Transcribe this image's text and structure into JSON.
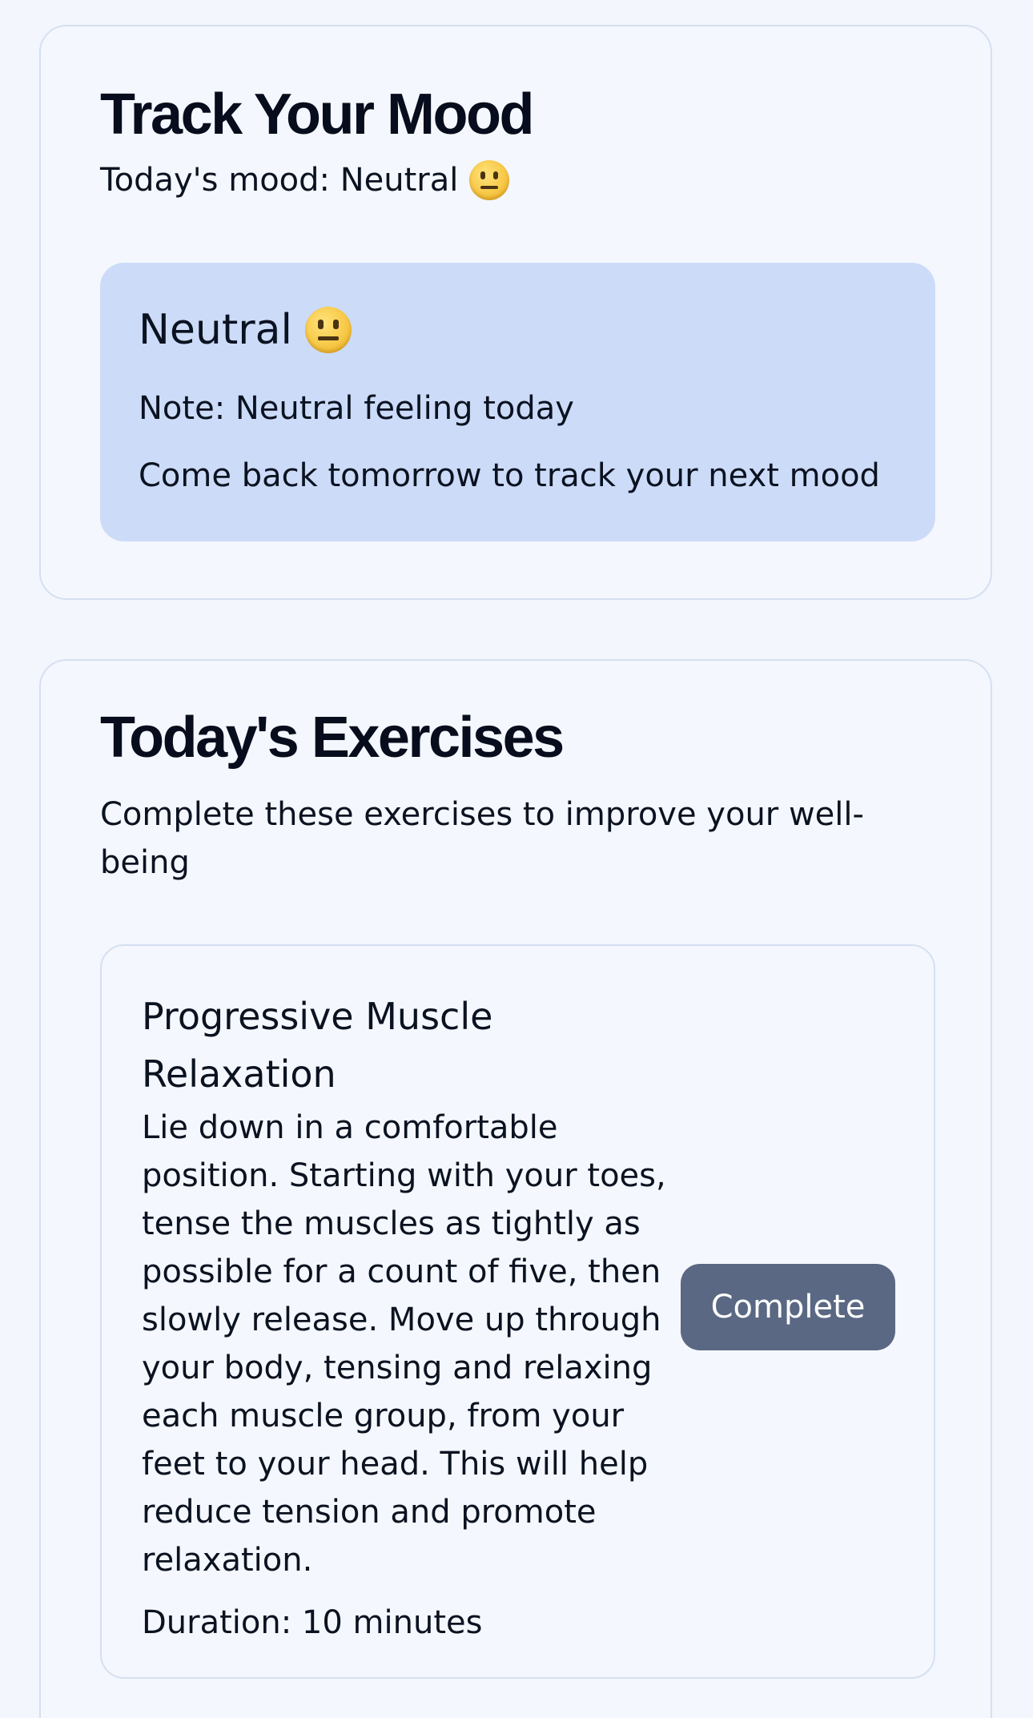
{
  "mood_card": {
    "title": "Track Your Mood",
    "todays_mood_prefix": "Today's mood: ",
    "todays_mood_value": "Neutral",
    "mood_icon": "neutral-face-icon",
    "entry": {
      "mood": "Neutral",
      "note": "Note: Neutral feeling today",
      "hint": "Come back tomorrow to track your next mood"
    }
  },
  "exercises_card": {
    "title": "Today's Exercises",
    "subtitle": "Complete these exercises to improve your well-being",
    "items": [
      {
        "title": "Progressive Muscle Relaxation",
        "description": "Lie down in a comfortable position. Starting with your toes, tense the muscles as tightly as possible for a count of five, then slowly release. Move up through your body, tensing and relaxing each muscle group, from your feet to your head. This will help reduce tension and promote relaxation.",
        "duration": "Duration: 10 minutes",
        "button_label": "Complete"
      }
    ]
  },
  "colors": {
    "background": "#f3f6fc",
    "card_border": "#d5e0f2",
    "mood_entry_bg": "#ccdbf8",
    "button_bg": "#5a6883",
    "button_text": "#ffffff",
    "text": "#0b1220"
  }
}
